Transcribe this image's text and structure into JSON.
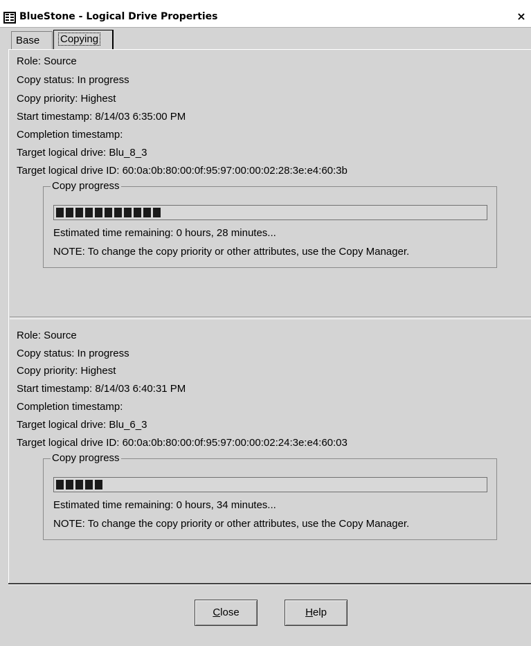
{
  "window": {
    "title": "BlueStone - Logical Drive Properties",
    "close_label": "×"
  },
  "tabs": [
    {
      "label": "Base",
      "selected": false
    },
    {
      "label": "Copying",
      "selected": true
    }
  ],
  "copies": [
    {
      "role": "Role: Source",
      "status": "Copy status: In progress",
      "priority": "Copy priority: Highest",
      "start": "Start timestamp: 8/14/03 6:35:00 PM",
      "completion": "Completion timestamp:",
      "target": "Target logical drive: Blu_8_3",
      "target_id": "Target logical drive ID: 60:0a:0b:80:00:0f:95:97:00:00:02:28:3e:e4:60:3b",
      "progress_legend": "Copy progress",
      "progress_fraction": 0.26,
      "remaining": "Estimated time remaining: 0 hours, 28 minutes...",
      "note": "NOTE: To change the copy priority or other attributes, use the Copy Manager."
    },
    {
      "role": "Role: Source",
      "status": "Copy status: In progress",
      "priority": "Copy priority: Highest",
      "start": "Start timestamp: 8/14/03 6:40:31 PM",
      "completion": "Completion timestamp:",
      "target": "Target logical drive: Blu_6_3",
      "target_id": "Target logical drive ID: 60:0a:0b:80:00:0f:95:97:00:00:02:24:3e:e4:60:03",
      "progress_legend": "Copy progress",
      "progress_fraction": 0.11,
      "remaining": "Estimated time remaining: 0 hours, 34 minutes...",
      "note": "NOTE: To change the copy priority or other attributes, use the Copy Manager."
    }
  ],
  "buttons": {
    "close_rest": "lose",
    "close_mnemonic": "C",
    "help_rest": "elp",
    "help_mnemonic": "H"
  }
}
